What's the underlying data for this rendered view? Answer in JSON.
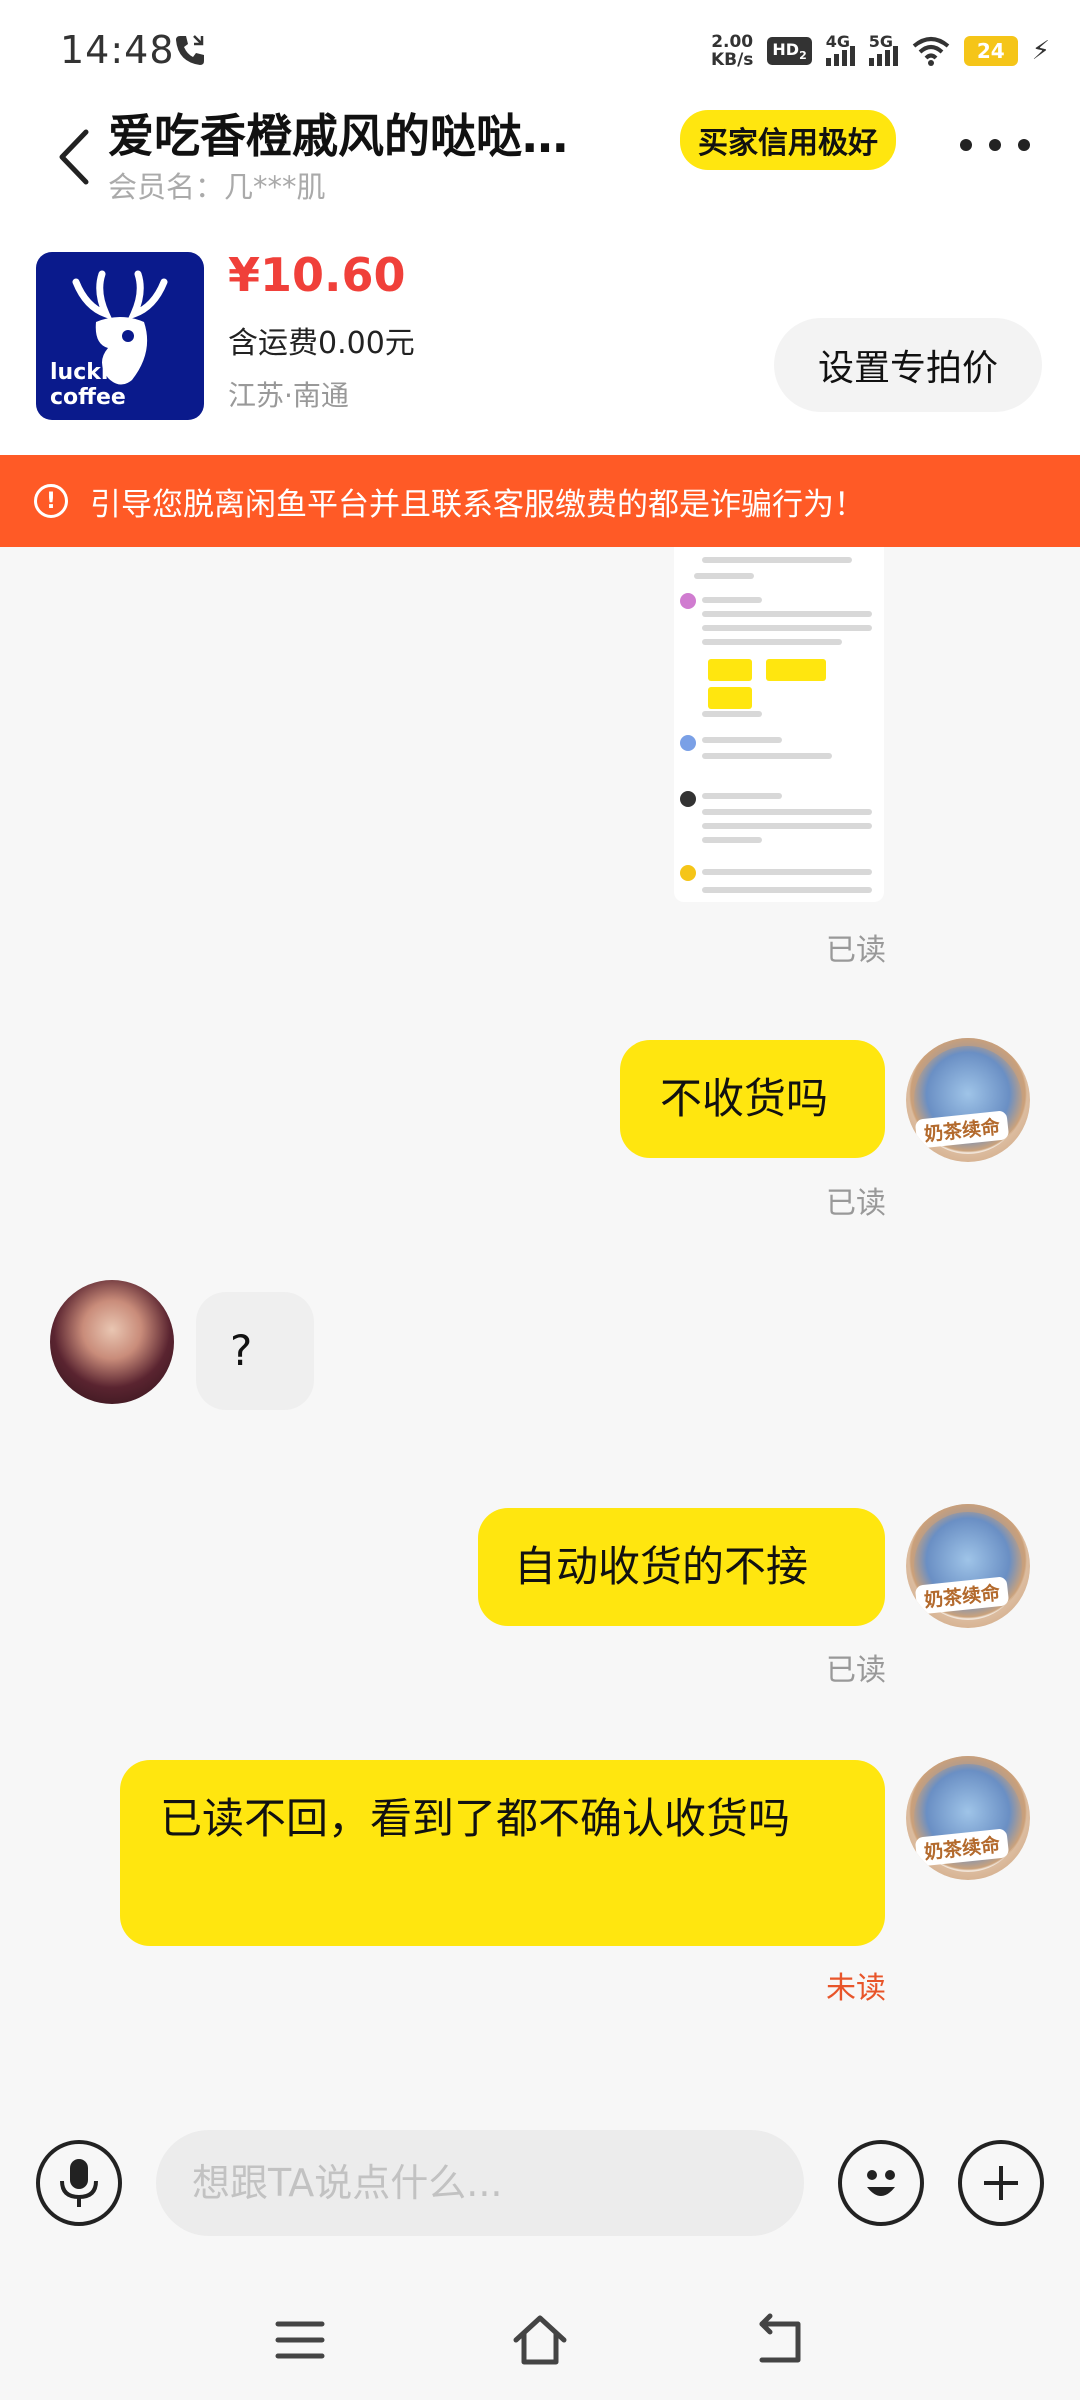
{
  "status_bar": {
    "time": "14:48",
    "net_speed_value": "2.00",
    "net_speed_unit": "KB/s",
    "hd_label": "HD",
    "hd_sub": "2",
    "net_4g": "4G",
    "net_5g": "5G",
    "battery": "24"
  },
  "header": {
    "title": "爱吃香橙戚风的哒哒…",
    "member_name": "会员名：几***肌",
    "credit_badge": "买家信用极好"
  },
  "product": {
    "brand": "luckin coffee",
    "price": "¥10.60",
    "shipping": "含运费0.00元",
    "location": "江苏·南通",
    "set_price_button": "设置专拍价"
  },
  "warning": {
    "text": "引导您脱离闲鱼平台并且联系客服缴费的都是诈骗行为！"
  },
  "messages": [
    {
      "id": "m0",
      "type": "image",
      "from": "me",
      "status": "已读"
    },
    {
      "id": "m1",
      "type": "text",
      "from": "me",
      "text": "不收货吗",
      "status": "已读"
    },
    {
      "id": "m2",
      "type": "text",
      "from": "them",
      "text": "?"
    },
    {
      "id": "m3",
      "type": "text",
      "from": "me",
      "text": "自动收货的不接",
      "status": "已读"
    },
    {
      "id": "m4",
      "type": "text",
      "from": "me",
      "text": "已读不回，看到了都不确认收货吗",
      "status": "未读"
    }
  ],
  "avatar_tag": "奶茶续命",
  "input": {
    "placeholder": "想跟TA说点什么..."
  },
  "colors": {
    "accent_yellow": "#ffe60f",
    "warning_orange": "#ff5a26",
    "price_red": "#f0403a",
    "unread_orange": "#e8552a"
  },
  "icons": [
    "call-icon",
    "back-icon",
    "more-icon",
    "warning-icon",
    "mic-icon",
    "emoji-icon",
    "plus-icon",
    "menu-icon",
    "home-icon",
    "back-nav-icon"
  ]
}
